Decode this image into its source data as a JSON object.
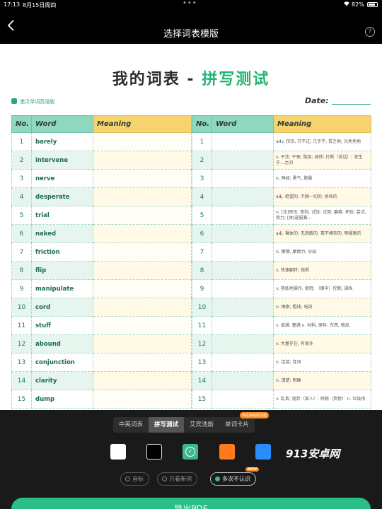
{
  "status_bar": {
    "time": "17:13",
    "date": "8月15日周四",
    "dots": "•••",
    "battery": "82%"
  },
  "nav": {
    "title": "选择词表模版",
    "help": "?"
  },
  "sheet": {
    "title_part1": "我的词表",
    "title_dash": "-",
    "title_part2": "拼写测试",
    "brand_label": "墨贝单词英语版",
    "date_label": "Date:"
  },
  "table_left": {
    "headers": {
      "no": "No.",
      "word": "Word",
      "meaning": "Meaning"
    },
    "rows": [
      {
        "no": "1",
        "word": "barely"
      },
      {
        "no": "2",
        "word": "intervene"
      },
      {
        "no": "3",
        "word": "nerve"
      },
      {
        "no": "4",
        "word": "desperate"
      },
      {
        "no": "5",
        "word": "trial"
      },
      {
        "no": "6",
        "word": "naked"
      },
      {
        "no": "7",
        "word": "friction"
      },
      {
        "no": "8",
        "word": "flip"
      },
      {
        "no": "9",
        "word": "manipulate"
      },
      {
        "no": "10",
        "word": "cord"
      },
      {
        "no": "11",
        "word": "stuff"
      },
      {
        "no": "12",
        "word": "abound"
      },
      {
        "no": "13",
        "word": "conjunction"
      },
      {
        "no": "14",
        "word": "clarity"
      },
      {
        "no": "15",
        "word": "dump"
      }
    ]
  },
  "table_right": {
    "headers": {
      "no": "No.",
      "word": "Word",
      "meaning": "Meaning"
    },
    "rows": [
      {
        "no": "1",
        "meaning": "adv. 仅仅, 只不过; 几乎不; 贫乏地; 光秃秃地"
      },
      {
        "no": "2",
        "meaning": "v. 干涉, 干预, 阻挠; 调停; 打断（说话）; 发生于…之间"
      },
      {
        "no": "3",
        "meaning": "n. 神经; 勇气, 胆量"
      },
      {
        "no": "4",
        "meaning": "adj. 绝望的; 不顾一切的, 拼命的"
      },
      {
        "no": "5",
        "meaning": "n. [法]审讯, 审判; 试验; 试用; 磨难, 考验; 尝试, 努力; [体]选拔赛…"
      },
      {
        "no": "6",
        "meaning": "adj. 裸体的; 无遮蔽的; 毫不掩饰的, 明摆着的"
      },
      {
        "no": "7",
        "meaning": "n. 摩擦, 摩擦力, 分歧"
      },
      {
        "no": "8",
        "meaning": "v. 快速翻转; 抛掷"
      },
      {
        "no": "9",
        "meaning": "v. 熟练地操作, 使用; （暗中）控制, 操纵"
      },
      {
        "no": "10",
        "meaning": "n. 绳索; 粗线; 电线"
      },
      {
        "no": "11",
        "meaning": "v. 填满, 塞满 n. 材料, 原料; 东西, 物品"
      },
      {
        "no": "12",
        "meaning": "v. 大量存在; 有很多"
      },
      {
        "no": "13",
        "meaning": "n. 连接; 连词"
      },
      {
        "no": "14",
        "meaning": "n. 清楚; 明确"
      },
      {
        "no": "15",
        "meaning": "v. 乱丢; 抛弃（某人）; 倾销（货物） n. 垃圾场"
      }
    ]
  },
  "template_tabs": {
    "items": [
      "中英词表",
      "拼写测试",
      "艾宾浩斯",
      "单词卡片"
    ],
    "active_index": 1,
    "badge": "专业高级版功能"
  },
  "colors": {
    "selected": "green",
    "swatches": [
      {
        "name": "white",
        "hex": "#ffffff"
      },
      {
        "name": "black",
        "hex": "#000000"
      },
      {
        "name": "green",
        "hex": "#3db88b"
      },
      {
        "name": "orange",
        "hex": "#ff7a1a"
      },
      {
        "name": "blue",
        "hex": "#2b8cff"
      }
    ]
  },
  "watermark": "913安卓网",
  "options": {
    "phonetic": "音标",
    "only_new": "只看新词",
    "often_wrong": "多次不认识",
    "new_badge": "NEW",
    "selected": "often_wrong"
  },
  "export_button": "导出PDF"
}
